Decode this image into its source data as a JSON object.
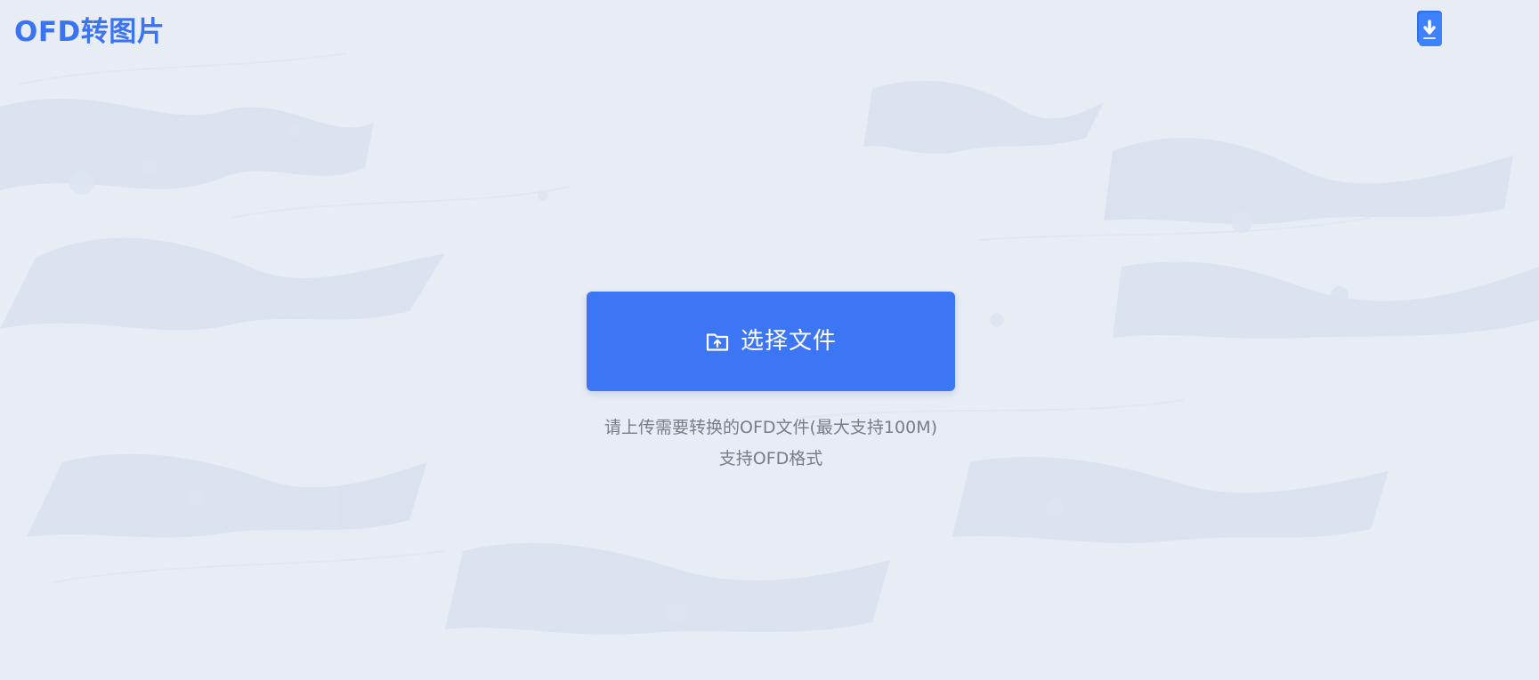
{
  "app": {
    "title": "OFD转图片"
  },
  "header": {
    "download_icon": "download-icon"
  },
  "upload": {
    "button_label": "选择文件",
    "button_icon": "folder-upload-icon",
    "hint_line1": "请上传需要转换的OFD文件(最大支持100M)",
    "hint_line2": "支持OFD格式"
  },
  "colors": {
    "accent": "#3d76f5",
    "title": "#3b74f0",
    "background": "#e8edf5",
    "hint_text": "#767d89"
  }
}
